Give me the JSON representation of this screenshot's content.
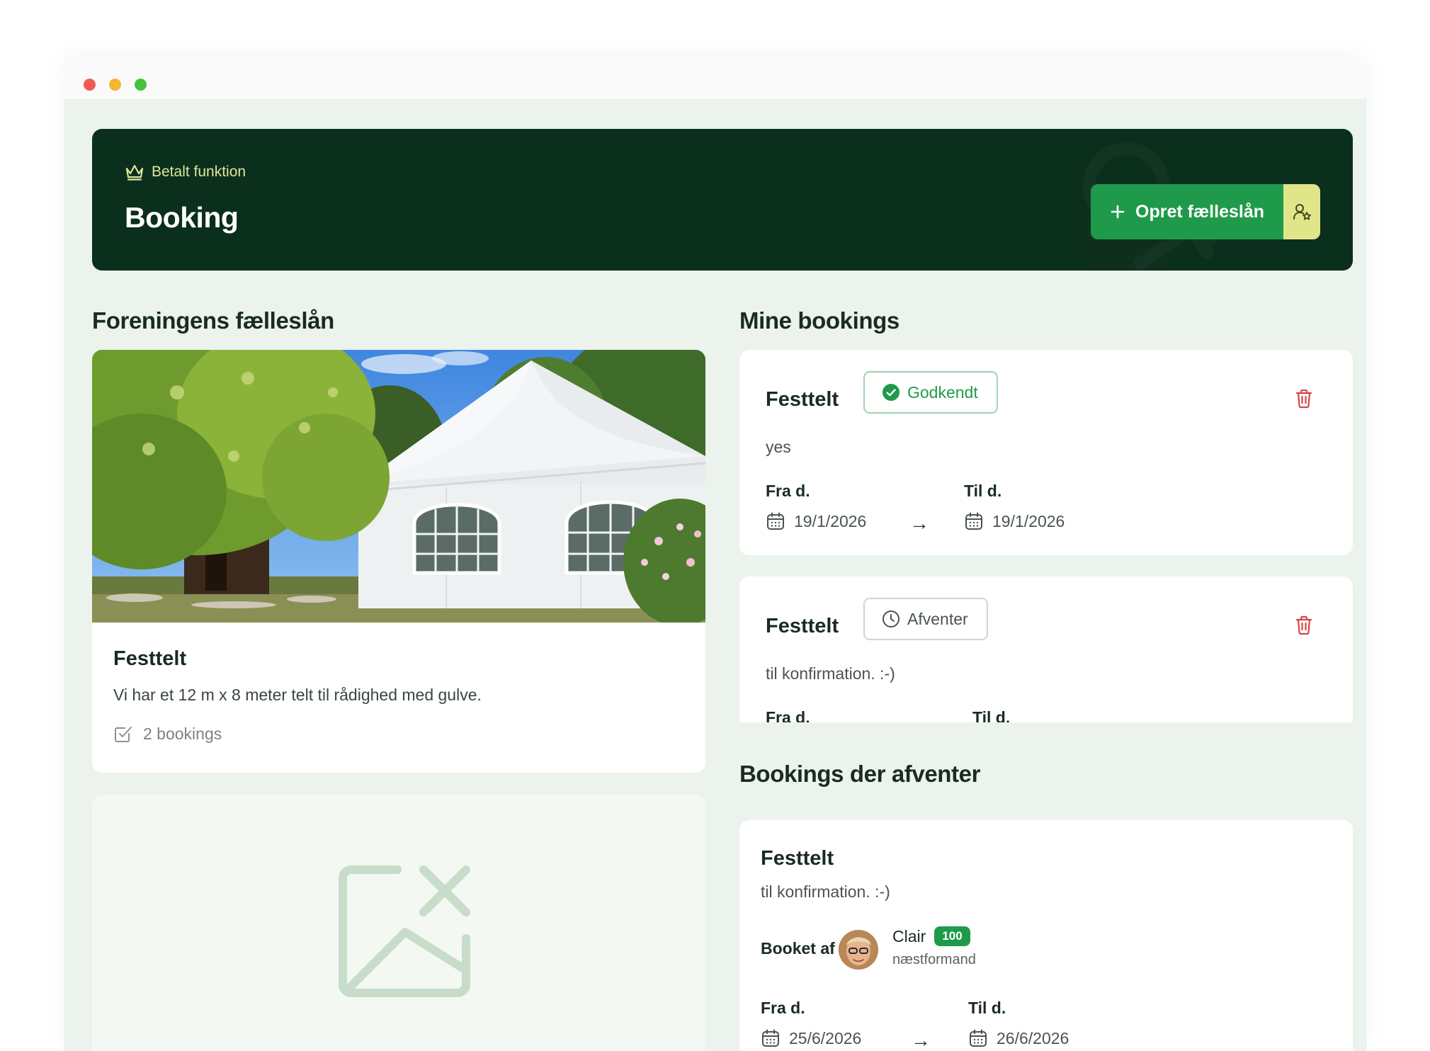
{
  "header": {
    "badge": "Betalt funktion",
    "title": "Booking",
    "create_button": "Opret fælleslån"
  },
  "sections": {
    "loans": "Foreningens fælleslån",
    "mine": "Mine bookings",
    "pending": "Bookings der afventer"
  },
  "loan": {
    "name": "Festtelt",
    "description": "Vi har et 12 m x 8 meter telt til rådighed med gulve.",
    "count": "2 bookings"
  },
  "labels": {
    "from": "Fra d.",
    "to": "Til d.",
    "booked_by": "Booket af"
  },
  "my_bookings": [
    {
      "name": "Festtelt",
      "status": "Godkendt",
      "note": "yes",
      "from": "19/1/2026",
      "to": "19/1/2026"
    },
    {
      "name": "Festtelt",
      "status": "Afventer",
      "note": "til konfirmation. :-)"
    }
  ],
  "pending": {
    "name": "Festtelt",
    "note": "til konfirmation. :-)",
    "user": "Clair",
    "points": "100",
    "role": "næstformand",
    "from": "25/6/2026",
    "to": "26/6/2026"
  },
  "colors": {
    "banner": "#0a2f1c",
    "accent": "#1f9a4a",
    "accent_light": "#e1e58a",
    "background": "#ebf3ec",
    "danger": "#d64545"
  }
}
